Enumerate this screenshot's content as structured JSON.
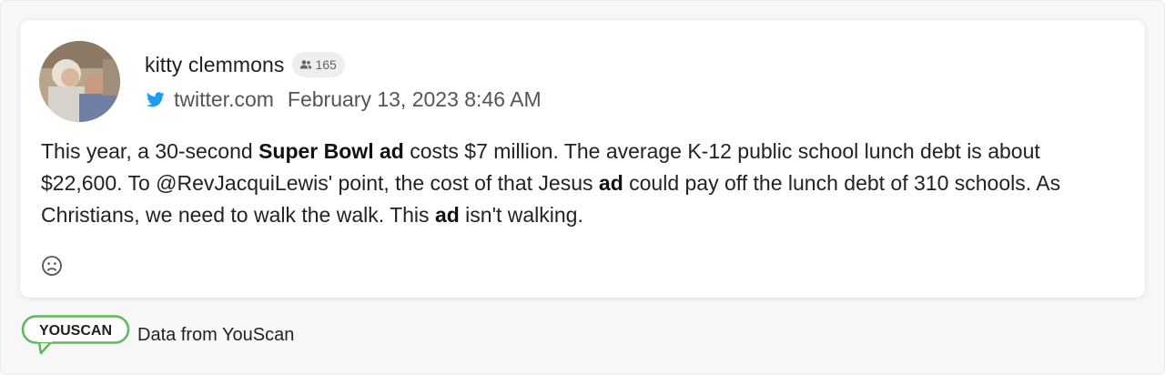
{
  "post": {
    "author_name": "kitty clemmons",
    "followers_count": "165",
    "source": "twitter.com",
    "date": "February 13, 2023 8:46 AM",
    "text_segments": [
      {
        "t": "This year, a 30-second ",
        "b": false
      },
      {
        "t": "Super Bowl ad",
        "b": true
      },
      {
        "t": " costs $7 million. The average K-12 public school lunch debt is about $22,600. To @RevJacquiLewis' point, the cost of that Jesus ",
        "b": false
      },
      {
        "t": "ad",
        "b": true
      },
      {
        "t": " could pay off the lunch debt of 310 schools. As Christians, we need to walk the walk. This ",
        "b": false
      },
      {
        "t": "ad",
        "b": true
      },
      {
        "t": " isn't walking.",
        "b": false
      }
    ],
    "sentiment_icon": "sad-face-icon"
  },
  "footer": {
    "logo_text": "YOUSCAN",
    "credit": "Data from YouScan"
  },
  "colors": {
    "twitter_blue": "#1d9bf0",
    "logo_green": "#5cb85c",
    "badge_bg": "#eeeeee"
  }
}
